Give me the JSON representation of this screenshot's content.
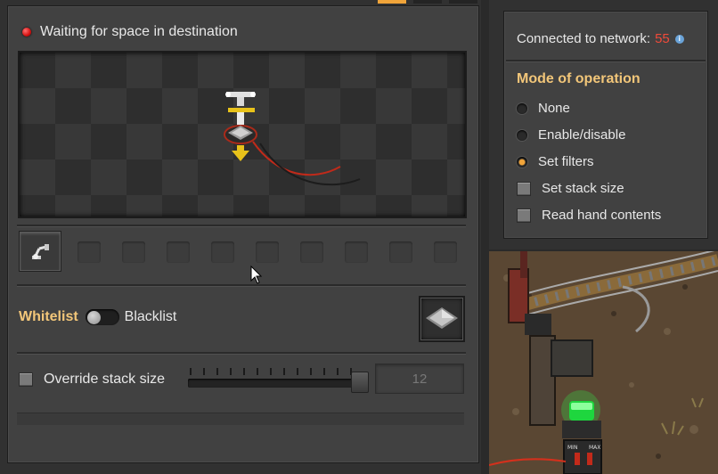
{
  "status": {
    "text": "Waiting for space in destination",
    "indicator_color": "#d41010"
  },
  "filter": {
    "whitelist_label": "Whitelist",
    "blacklist_label": "Blacklist",
    "mode": "Whitelist",
    "item_icon": "steel-plate-icon"
  },
  "override": {
    "label": "Override stack size",
    "checked": false,
    "slider_value": 12,
    "input_value": "12"
  },
  "circuit": {
    "connected_label": "Connected to network:",
    "network_id": "55",
    "mode_title": "Mode of operation",
    "options": [
      {
        "label": "None",
        "type": "radio",
        "selected": false
      },
      {
        "label": "Enable/disable",
        "type": "radio",
        "selected": false
      },
      {
        "label": "Set filters",
        "type": "radio",
        "selected": true
      },
      {
        "label": "Set stack size",
        "type": "checkbox",
        "checked": false
      },
      {
        "label": "Read hand contents",
        "type": "checkbox",
        "checked": false
      }
    ]
  },
  "colors": {
    "accent": "#f0a43a",
    "heading": "#f2c679",
    "network_id": "#ef4a3a",
    "panel_bg": "#414141"
  }
}
